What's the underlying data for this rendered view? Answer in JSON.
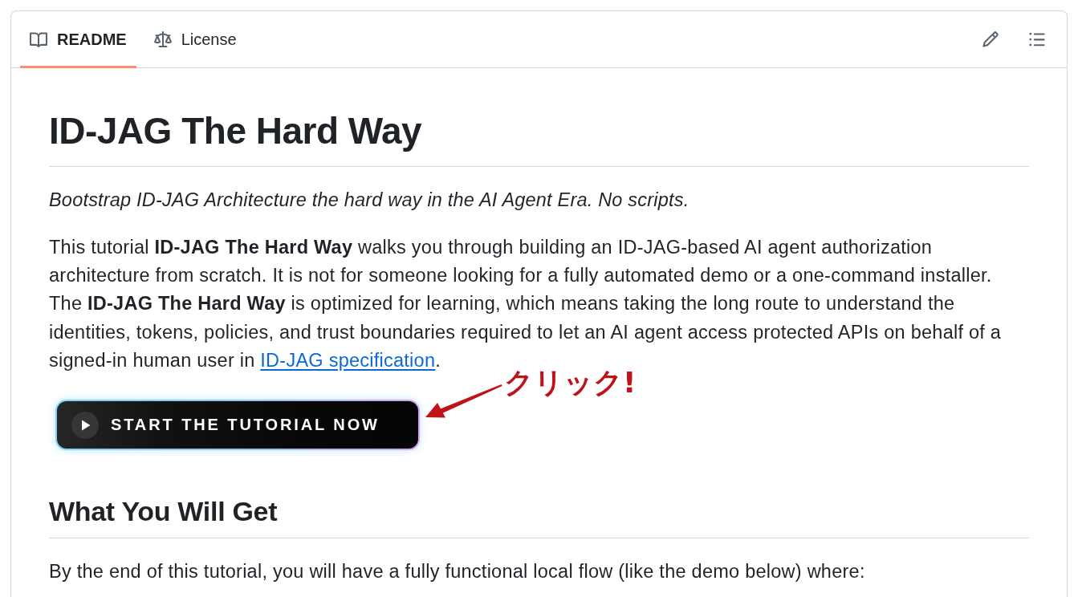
{
  "tabs": [
    {
      "label": "README",
      "selected": true,
      "kind": "readme"
    },
    {
      "label": "License",
      "selected": false,
      "kind": "license"
    }
  ],
  "readme": {
    "title": "ID-JAG The Hard Way",
    "tagline": "Bootstrap ID-JAG Architecture the hard way in the AI Agent Era. No scripts.",
    "intro": {
      "text": "This tutorial **ID-JAG The Hard Way** walks you through building an ID-JAG-based AI agent authorization architecture from scratch. It is not for someone looking for a fully automated demo or a one-command installer. The **ID-JAG The Hard Way** is optimized for learning, which means taking the long route to understand the identities, tokens, policies, and trust boundaries required to let an AI agent access protected APIs on behalf of a signed-in human user in ",
      "link": "ID-JAG specification",
      "after": "."
    },
    "cta_button": {
      "label": "START THE TUTORIAL NOW"
    },
    "annotation": "クリック!",
    "section_heading": "What You Will Get",
    "section_text": "By the end of this tutorial, you will have a fully functional local flow (like the demo below) where:"
  }
}
